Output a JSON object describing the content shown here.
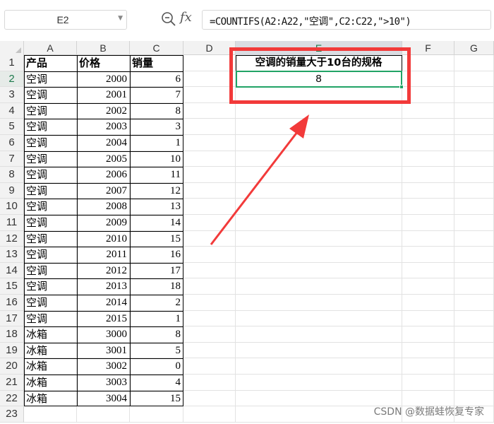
{
  "formula_bar": {
    "name_box": "E2",
    "fx_label": "fx",
    "formula": "=COUNTIFS(A2:A22,\"空调\",C2:C22,\">10\")"
  },
  "columns": [
    "A",
    "B",
    "C",
    "D",
    "E",
    "F",
    "G"
  ],
  "row_numbers": [
    "1",
    "2",
    "3",
    "4",
    "5",
    "6",
    "7",
    "8",
    "9",
    "10",
    "11",
    "12",
    "13",
    "14",
    "15",
    "16",
    "17",
    "18",
    "19",
    "20",
    "21",
    "22",
    "23"
  ],
  "headers": {
    "a1": "产品",
    "b1": "价格",
    "c1": "销量"
  },
  "rows": [
    [
      "空调",
      "2000",
      "6"
    ],
    [
      "空调",
      "2001",
      "7"
    ],
    [
      "空调",
      "2002",
      "8"
    ],
    [
      "空调",
      "2003",
      "3"
    ],
    [
      "空调",
      "2004",
      "1"
    ],
    [
      "空调",
      "2005",
      "10"
    ],
    [
      "空调",
      "2006",
      "11"
    ],
    [
      "空调",
      "2007",
      "12"
    ],
    [
      "空调",
      "2008",
      "13"
    ],
    [
      "空调",
      "2009",
      "14"
    ],
    [
      "空调",
      "2010",
      "15"
    ],
    [
      "空调",
      "2011",
      "16"
    ],
    [
      "空调",
      "2012",
      "17"
    ],
    [
      "空调",
      "2013",
      "18"
    ],
    [
      "空调",
      "2014",
      "2"
    ],
    [
      "空调",
      "2015",
      "1"
    ],
    [
      "冰箱",
      "3000",
      "8"
    ],
    [
      "冰箱",
      "3001",
      "5"
    ],
    [
      "冰箱",
      "3002",
      "0"
    ],
    [
      "冰箱",
      "3003",
      "4"
    ],
    [
      "冰箱",
      "3004",
      "15"
    ]
  ],
  "result": {
    "e1_label": "空调的销量大于10台的规格",
    "e2_value": "8"
  },
  "watermark": "CSDN @数据蛙恢复专家",
  "colors": {
    "selection": "#21a366",
    "annotation": "#f23a3a",
    "header_bg": "#f2f2f2"
  }
}
